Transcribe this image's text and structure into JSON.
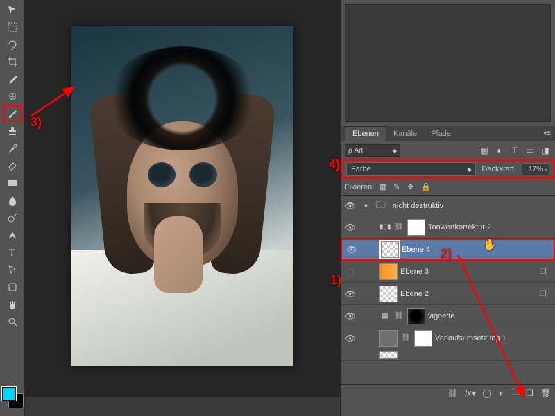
{
  "tools": [
    "move",
    "marquee",
    "lasso",
    "wand-crop",
    "crop",
    "eyedropper",
    "healing",
    "brush",
    "stamp",
    "history-brush",
    "eraser",
    "gradient",
    "blur",
    "dodge",
    "pen",
    "type",
    "path-select",
    "shape",
    "hand",
    "zoom"
  ],
  "swatches": {
    "foreground": "#00d4ff",
    "background": "#000000"
  },
  "panels": {
    "tabs": [
      "Ebenen",
      "Kanäle",
      "Pfade"
    ],
    "active_tab": "Ebenen",
    "filter_label": "Art",
    "blend_mode": "Farbe",
    "opacity_label": "Deckkraft:",
    "opacity_value": "17%",
    "lock_label": "Fixieren:"
  },
  "layers": {
    "group": "nicht destruktiv",
    "items": [
      {
        "name": "Tonwertkorrektur 2",
        "type": "adjustment"
      },
      {
        "name": "Ebene 4",
        "type": "pixel",
        "selected": true
      },
      {
        "name": "Ebene 3",
        "type": "pixel"
      },
      {
        "name": "Ebene 2",
        "type": "pixel"
      },
      {
        "name": "vignette",
        "type": "mask"
      },
      {
        "name": "Verlaufsumsetzung 1",
        "type": "adjustment"
      }
    ]
  },
  "annotations": {
    "a1": "1)",
    "a2": "2)",
    "a3": "3)",
    "a4": "4)"
  }
}
